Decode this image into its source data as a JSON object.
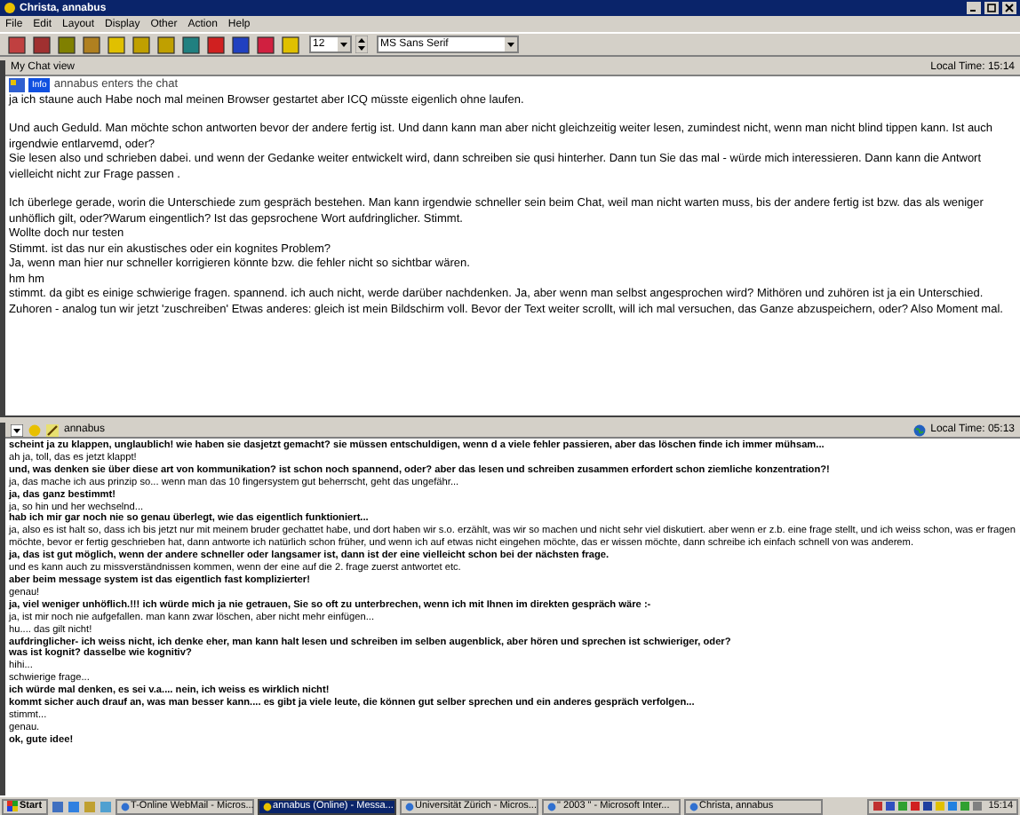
{
  "window": {
    "title": "Christa, annabus"
  },
  "menu": [
    "File",
    "Edit",
    "Layout",
    "Display",
    "Other",
    "Action",
    "Help"
  ],
  "toolbar": {
    "font_size": "12",
    "font": "MS Sans Serif"
  },
  "upper_pane": {
    "title": "My Chat view",
    "local_time": "Local Time: 15:14",
    "badge": "Info",
    "join_notice": "annabus enters the chat",
    "paragraphs": [
      [
        "ja ich staune auch Habe noch mal meinen Browser gestartet aber ICQ müsste eigenlich ohne laufen."
      ],
      [
        "Und auch Geduld. Man möchte schon antworten bevor der andere fertig ist. Und dann kann man aber nicht gleichzeitig weiter lesen, zumindest nicht, wenn man nicht blind tippen kann. Ist auch irgendwie entlarvemd, oder?",
        "Sie lesen also und schrieben dabei. und wenn der Gedanke weiter entwickelt wird, dann schreiben sie qusi hinterher. Dann tun Sie das mal - würde mich interessieren. Dann kann die Antwort vielleicht nicht zur Frage passen ."
      ],
      [
        "Ich überlege gerade, worin die Unterschiede zum gespräch bestehen. Man kann irgendwie schneller sein beim Chat, weil man nicht warten muss, bis der andere fertig ist bzw. das als weniger unhöflich gilt, oder?Warum eingentlich? Ist das gepsrochene Wort aufdringlicher. Stimmt.",
        "Wollte doch nur testen",
        "Stimmt. ist das nur ein akustisches oder ein kognites Problem?",
        "Ja, wenn man hier nur schneller korrigieren könnte bzw. die fehler nicht so sichtbar wären.",
        "hm hm",
        "stimmt. da gibt es einige schwierige fragen. spannend. ich auch nicht, werde darüber nachdenken. Ja, aber wenn man selbst angesprochen wird? Mithören und zuhören ist ja ein Unterschied. Zuhoren - analog tun wir jetzt 'zuschreiben' Etwas anderes: gleich ist mein Bildschirm voll. Bevor der Text weiter scrollt, will ich mal versuchen, das Ganze abzuspeichern, oder? Also Moment mal."
      ]
    ]
  },
  "lower_pane": {
    "title": "annabus",
    "local_time": "Local Time: 05:13",
    "lines": [
      {
        "text": "scheint ja zu klappen, unglaublich! wie haben sie dasjetzt gemacht? sie müssen entschuldigen, wenn d a viele fehler passieren, aber das löschen finde ich immer mühsam...",
        "bold": true
      },
      {
        "text": "ah ja, toll, das es jetzt klappt!",
        "bold": false
      },
      {
        "text": "und, was denken sie über diese art von kommunikation? ist schon noch spannend, oder? aber das lesen und schreiben zusammen erfordert schon ziemliche konzentration?!",
        "bold": true
      },
      {
        "text": "ja, das mache ich aus prinzip so... wenn man das 10 fingersystem gut beherrscht, geht das ungefähr...",
        "bold": false
      },
      {
        "text": "ja, das ganz bestimmt!",
        "bold": true
      },
      {
        "text": "ja, so hin und her wechselnd...",
        "bold": false
      },
      {
        "text": "hab ich mir gar noch nie so genau überlegt, wie das eigentlich funktioniert...",
        "bold": true
      },
      {
        "text": "ja, also es ist halt so, dass ich bis jetzt nur mit meinem bruder gechattet habe, und dort haben wir s.o. erzählt, was wir so machen und nicht sehr viel diskutiert. aber wenn er z.b. eine frage stellt, und ich weiss schon, was er fragen möchte, bevor er fertig geschrieben hat, dann antworte ich natürlich schon früher, und wenn ich auf etwas nicht eingehen möchte, das er wissen möchte, dann schreibe ich einfach schnell von was anderem.",
        "bold": false
      },
      {
        "text": "ja, das ist gut möglich, wenn der andere schneller oder langsamer ist, dann ist der eine vielleicht schon bei der nächsten frage.",
        "bold": true
      },
      {
        "text": "und es kann auch zu missverständnissen kommen, wenn der eine auf die 2. frage zuerst antwortet etc.",
        "bold": false
      },
      {
        "text": "aber beim message system ist das eigentlich fast komplizierter!",
        "bold": true
      },
      {
        "text": "genau!",
        "bold": false
      },
      {
        "text": "ja, viel weniger unhöflich.!!! ich würde mich ja nie getrauen, Sie so oft zu unterbrechen, wenn ich mit Ihnen im direkten gespräch wäre :-",
        "bold": true
      },
      {
        "text": "ja, ist mir noch nie aufgefallen. man kann zwar löschen, aber nicht mehr einfügen...",
        "bold": false
      },
      {
        "text": "hu.... das gilt nicht!",
        "bold": false
      },
      {
        "text": "aufdringlicher- ich weiss nicht, ich denke eher, man kann halt lesen und schreiben im selben augenblick, aber hören und sprechen ist schwieriger, oder?",
        "bold": true
      },
      {
        "text": "was ist kognit? dasselbe wie kognitiv?",
        "bold": true
      },
      {
        "text": "hihi...",
        "bold": false
      },
      {
        "text": "schwierige frage...",
        "bold": false
      },
      {
        "text": "ich würde mal denken, es sei v.a.... nein, ich weiss es wirklich nicht!",
        "bold": true
      },
      {
        "text": "kommt sicher auch drauf an, was man besser kann.... es gibt ja viele leute, die können gut selber sprechen und ein anderes gespräch verfolgen...",
        "bold": true
      },
      {
        "text": "stimmt...",
        "bold": false
      },
      {
        "text": "genau.",
        "bold": false
      },
      {
        "text": "ok, gute idee!",
        "bold": true
      }
    ]
  },
  "taskbar": {
    "start": "Start",
    "tasks": [
      {
        "label": "T-Online WebMail - Micros...",
        "selected": false
      },
      {
        "label": "annabus (Online) - Messa...",
        "selected": true
      },
      {
        "label": "Universität Zürich - Micros...",
        "selected": false
      },
      {
        "label": "\" 2003 \" - Microsoft Inter...",
        "selected": false
      },
      {
        "label": "Christa, annabus",
        "selected": false
      }
    ],
    "clock": "15:14"
  }
}
